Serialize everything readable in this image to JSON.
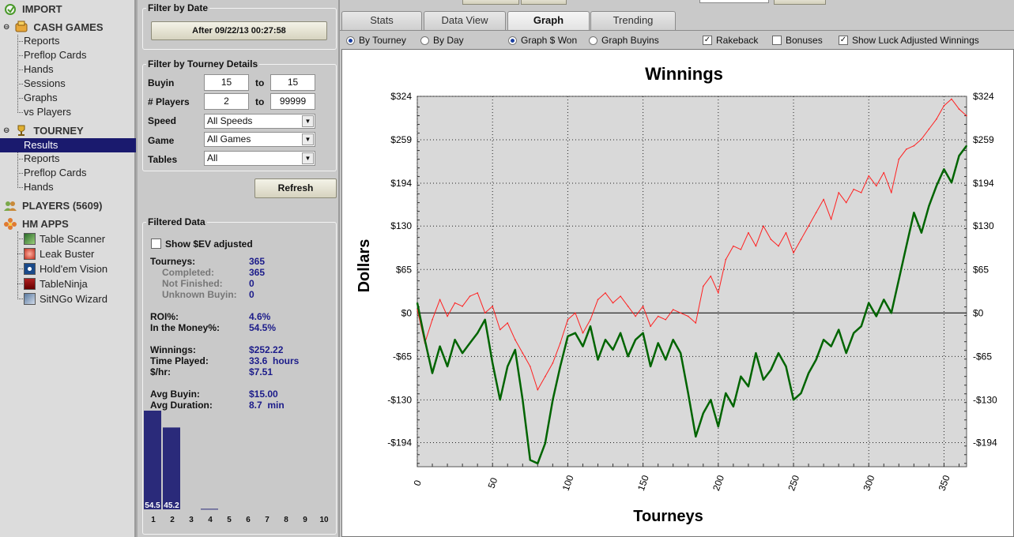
{
  "nav": {
    "import": "IMPORT",
    "cash_games": "CASH GAMES",
    "cash_items": [
      "Reports",
      "Preflop Cards",
      "Hands",
      "Sessions",
      "Graphs",
      "vs Players"
    ],
    "tourney": "TOURNEY",
    "tourney_items": [
      "Results",
      "Reports",
      "Preflop Cards",
      "Hands"
    ],
    "players": "PLAYERS (5609)",
    "hm_apps": "HM APPS",
    "apps": [
      "Table Scanner",
      "Leak Buster",
      "Hold'em Vision",
      "TableNinja",
      "SitNGo Wizard"
    ]
  },
  "filters": {
    "date_title": "Filter by Date",
    "date_button": "After 09/22/13 00:27:58",
    "details_title": "Filter by Tourney Details",
    "buyin_label": "Buyin",
    "buyin_from": "15",
    "buyin_to": "15",
    "players_label": "# Players",
    "players_from": "2",
    "players_to": "99999",
    "to": "to",
    "speed_label": "Speed",
    "speed_value": "All Speeds",
    "game_label": "Game",
    "game_value": "All Games",
    "tables_label": "Tables",
    "tables_value": "All",
    "refresh": "Refresh"
  },
  "filtered": {
    "title": "Filtered Data",
    "show_ev": "Show $EV adjusted",
    "tourneys_l": "Tourneys:",
    "tourneys_v": "365",
    "completed_l": "Completed:",
    "completed_v": "365",
    "notfinished_l": "Not Finished:",
    "notfinished_v": "0",
    "unknown_l": "Unknown Buyin:",
    "unknown_v": "0",
    "roi_l": "ROI%:",
    "roi_v": "4.6%",
    "itm_l": "In the Money%:",
    "itm_v": "54.5%",
    "winnings_l": "Winnings:",
    "winnings_v": "$252.22",
    "time_l": "Time Played:",
    "time_v": "33.6  hours",
    "hr_l": "$/hr:",
    "hr_v": "$7.51",
    "avgbuy_l": "Avg Buyin:",
    "avgbuy_v": "$15.00",
    "avgdur_l": "Avg Duration:",
    "avgdur_v": "8.7  min",
    "finish_bars": {
      "positions": [
        "1",
        "2",
        "3",
        "4",
        "5",
        "6",
        "7",
        "8",
        "9",
        "10"
      ],
      "values": [
        54.5,
        45.2,
        0,
        0.3,
        0,
        0,
        0,
        0,
        0,
        0
      ],
      "labels": [
        "54.5",
        "45.2"
      ]
    }
  },
  "tabs": [
    "Stats",
    "Data View",
    "Graph",
    "Trending"
  ],
  "options": {
    "by_tourney": "By Tourney",
    "by_day": "By Day",
    "graph_won": "Graph $ Won",
    "graph_buyins": "Graph Buyins",
    "rakeback": "Rakeback",
    "bonuses": "Bonuses",
    "luck": "Show Luck Adjusted Winnings"
  },
  "chart_data": {
    "type": "line",
    "title": "Winnings",
    "xlabel": "Tourneys",
    "ylabel": "Dollars",
    "xlim": [
      0,
      365
    ],
    "ylim": [
      -230,
      324
    ],
    "xticks": [
      0,
      50,
      100,
      150,
      200,
      250,
      300,
      350
    ],
    "yticks": [
      324,
      259,
      194,
      130,
      65,
      0,
      -65,
      -130,
      -194
    ],
    "ytick_labels": [
      "$324",
      "$259",
      "$194",
      "$130",
      "$65",
      "$0",
      "-$65",
      "-$130",
      "-$194"
    ],
    "grid": true,
    "series": [
      {
        "color": "#ff2020",
        "x": [
          0,
          5,
          10,
          15,
          20,
          25,
          30,
          35,
          40,
          45,
          50,
          55,
          60,
          65,
          70,
          75,
          80,
          85,
          90,
          95,
          100,
          105,
          110,
          115,
          120,
          125,
          130,
          135,
          140,
          145,
          150,
          155,
          160,
          165,
          170,
          175,
          180,
          185,
          190,
          195,
          200,
          205,
          210,
          215,
          220,
          225,
          230,
          235,
          240,
          245,
          250,
          255,
          260,
          265,
          270,
          275,
          280,
          285,
          290,
          295,
          300,
          305,
          310,
          315,
          320,
          325,
          330,
          335,
          340,
          345,
          350,
          355,
          360,
          365
        ],
        "y": [
          5,
          -45,
          -10,
          20,
          -5,
          15,
          10,
          25,
          30,
          0,
          10,
          -25,
          -15,
          -40,
          -60,
          -80,
          -115,
          -95,
          -75,
          -45,
          -10,
          0,
          -30,
          -10,
          20,
          30,
          15,
          25,
          10,
          -5,
          10,
          -20,
          -5,
          -10,
          5,
          0,
          -5,
          -15,
          40,
          55,
          30,
          80,
          100,
          95,
          120,
          100,
          130,
          110,
          100,
          120,
          90,
          110,
          130,
          150,
          170,
          140,
          180,
          165,
          185,
          180,
          205,
          190,
          210,
          180,
          230,
          245,
          250,
          260,
          275,
          290,
          310,
          320,
          305,
          295
        ]
      },
      {
        "color": "#006400",
        "x": [
          0,
          5,
          10,
          15,
          20,
          25,
          30,
          35,
          40,
          45,
          50,
          55,
          60,
          65,
          70,
          75,
          80,
          85,
          90,
          95,
          100,
          105,
          110,
          115,
          120,
          125,
          130,
          135,
          140,
          145,
          150,
          155,
          160,
          165,
          170,
          175,
          180,
          185,
          190,
          195,
          200,
          205,
          210,
          215,
          220,
          225,
          230,
          235,
          240,
          245,
          250,
          255,
          260,
          265,
          270,
          275,
          280,
          285,
          290,
          295,
          300,
          305,
          310,
          315,
          320,
          325,
          330,
          335,
          340,
          345,
          350,
          355,
          360,
          365
        ],
        "y": [
          15,
          -40,
          -90,
          -50,
          -80,
          -40,
          -60,
          -45,
          -30,
          -10,
          -75,
          -130,
          -80,
          -55,
          -130,
          -220,
          -225,
          -195,
          -130,
          -80,
          -35,
          -30,
          -50,
          -20,
          -70,
          -40,
          -55,
          -30,
          -65,
          -40,
          -30,
          -80,
          -45,
          -70,
          -40,
          -60,
          -120,
          -185,
          -150,
          -130,
          -170,
          -120,
          -140,
          -95,
          -110,
          -60,
          -100,
          -85,
          -60,
          -80,
          -130,
          -120,
          -90,
          -70,
          -40,
          -50,
          -25,
          -60,
          -30,
          -20,
          15,
          -5,
          20,
          0,
          50,
          100,
          150,
          120,
          160,
          190,
          215,
          195,
          235,
          250
        ]
      }
    ]
  }
}
